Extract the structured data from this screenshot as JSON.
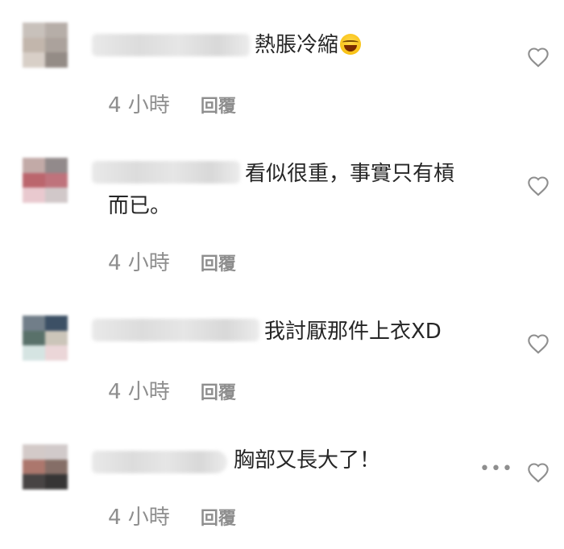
{
  "comments": [
    {
      "text": "熱脹冷縮",
      "emoji": "face-with-tears-of-joy",
      "time": "4 小時",
      "reply": "回覆",
      "avatar_colors": [
        "#c6beb8",
        "#b3aaa4",
        "#bfb3a8",
        "#a79e97",
        "#d6cdc5",
        "#8f8680"
      ]
    },
    {
      "text_line1": "看似很重，事實只有槓",
      "text_line2": "而已。",
      "time": "4 小時",
      "reply": "回覆",
      "avatar_colors": [
        "#bfa6a3",
        "#8d8485",
        "#b85e66",
        "#bc6c75",
        "#e8c7cd",
        "#cfc6c7"
      ]
    },
    {
      "text": "我討厭那件上衣XD",
      "time": "4 小時",
      "reply": "回覆",
      "avatar_colors": [
        "#6a7883",
        "#32475d",
        "#516a63",
        "#c9c2b6",
        "#d3e3e1",
        "#ead4d6"
      ]
    },
    {
      "text": "胸部又長大了！",
      "time": "4 小時",
      "reply": "回覆",
      "more": "•••",
      "avatar_colors": [
        "#d1c8c6",
        "#cfc8c8",
        "#a87066",
        "#7f675f",
        "#3f3b3b",
        "#2c2b2b"
      ]
    }
  ],
  "icons": {
    "like": "heart-outline-icon",
    "more": "more-options-icon",
    "emoji": "face-with-tears-of-joy-icon"
  },
  "colors": {
    "text": "#262626",
    "secondary": "#8e8e8e",
    "icon": "#8e8e8e"
  }
}
